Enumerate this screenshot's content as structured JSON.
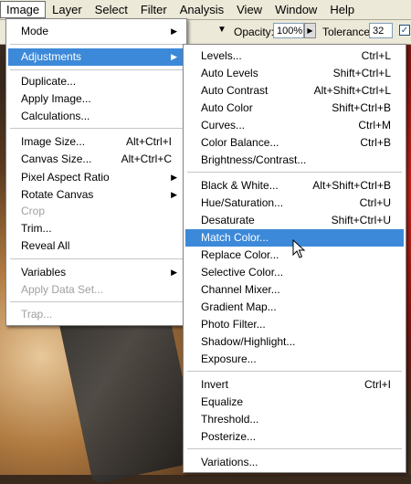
{
  "menubar": {
    "items": [
      "Image",
      "Layer",
      "Select",
      "Filter",
      "Analysis",
      "View",
      "Window",
      "Help"
    ]
  },
  "options": {
    "opacity_label": "Opacity:",
    "opacity_value": "100%",
    "tolerance_label": "Tolerance:",
    "tolerance_value": "32"
  },
  "image_menu": {
    "mode": "Mode",
    "adjustments": "Adjustments",
    "duplicate": "Duplicate...",
    "apply_image": "Apply Image...",
    "calculations": "Calculations...",
    "image_size": "Image Size...",
    "image_size_sc": "Alt+Ctrl+I",
    "canvas_size": "Canvas Size...",
    "canvas_size_sc": "Alt+Ctrl+C",
    "pixel_aspect": "Pixel Aspect Ratio",
    "rotate_canvas": "Rotate Canvas",
    "crop": "Crop",
    "trim": "Trim...",
    "reveal_all": "Reveal All",
    "variables": "Variables",
    "apply_data_set": "Apply Data Set...",
    "trap": "Trap..."
  },
  "adjust_menu": {
    "levels": "Levels...",
    "levels_sc": "Ctrl+L",
    "auto_levels": "Auto Levels",
    "auto_levels_sc": "Shift+Ctrl+L",
    "auto_contrast": "Auto Contrast",
    "auto_contrast_sc": "Alt+Shift+Ctrl+L",
    "auto_color": "Auto Color",
    "auto_color_sc": "Shift+Ctrl+B",
    "curves": "Curves...",
    "curves_sc": "Ctrl+M",
    "color_balance": "Color Balance...",
    "color_balance_sc": "Ctrl+B",
    "brightness": "Brightness/Contrast...",
    "black_white": "Black & White...",
    "black_white_sc": "Alt+Shift+Ctrl+B",
    "hue_sat": "Hue/Saturation...",
    "hue_sat_sc": "Ctrl+U",
    "desaturate": "Desaturate",
    "desaturate_sc": "Shift+Ctrl+U",
    "match_color": "Match Color...",
    "replace_color": "Replace Color...",
    "selective_color": "Selective Color...",
    "channel_mixer": "Channel Mixer...",
    "gradient_map": "Gradient Map...",
    "photo_filter": "Photo Filter...",
    "shadow_highlight": "Shadow/Highlight...",
    "exposure": "Exposure...",
    "invert": "Invert",
    "invert_sc": "Ctrl+I",
    "equalize": "Equalize",
    "threshold": "Threshold...",
    "posterize": "Posterize...",
    "variations": "Variations..."
  },
  "colors": {
    "highlight": "#3d89d9",
    "menubar_bg": "#ece9d8",
    "disabled_text": "#a0a0a0"
  }
}
